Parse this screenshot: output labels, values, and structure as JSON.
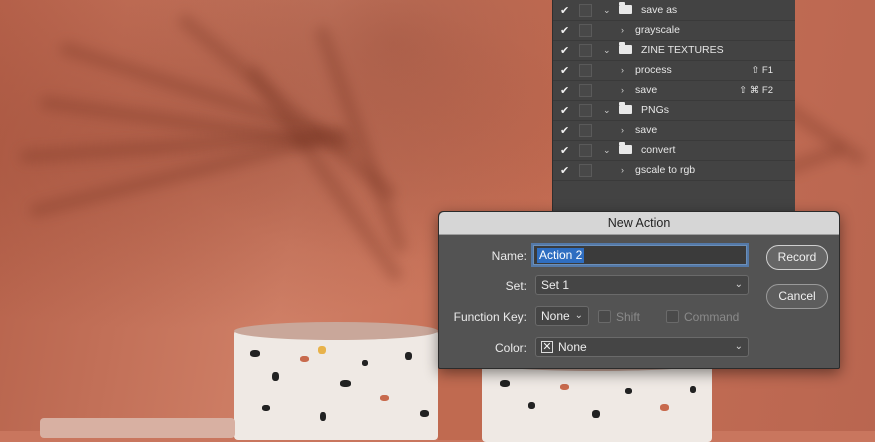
{
  "actions_panel": {
    "rows": [
      {
        "type": "folder",
        "label": "save as",
        "key": ""
      },
      {
        "type": "action",
        "label": "grayscale",
        "key": ""
      },
      {
        "type": "folder",
        "label": "ZINE TEXTURES",
        "key": ""
      },
      {
        "type": "action",
        "label": "process",
        "key": "⇧ F1"
      },
      {
        "type": "action",
        "label": "save",
        "key": "⇧ ⌘ F2"
      },
      {
        "type": "folder",
        "label": "PNGs",
        "key": ""
      },
      {
        "type": "action",
        "label": "save",
        "key": ""
      },
      {
        "type": "folder",
        "label": "convert",
        "key": ""
      },
      {
        "type": "action",
        "label": "gscale to rgb",
        "key": ""
      }
    ]
  },
  "dialog": {
    "title": "New Action",
    "name_label": "Name:",
    "name_value": "Action 2",
    "set_label": "Set:",
    "set_value": "Set 1",
    "function_key_label": "Function Key:",
    "function_key_value": "None",
    "shift_label": "Shift",
    "command_label": "Command",
    "color_label": "Color:",
    "color_value": "None",
    "record_label": "Record",
    "cancel_label": "Cancel"
  },
  "icons": {
    "check": "✔",
    "chevron_right": "›",
    "chevron_down": "⌄",
    "dropdown_arrow": "⌄",
    "no_color": "✕"
  }
}
